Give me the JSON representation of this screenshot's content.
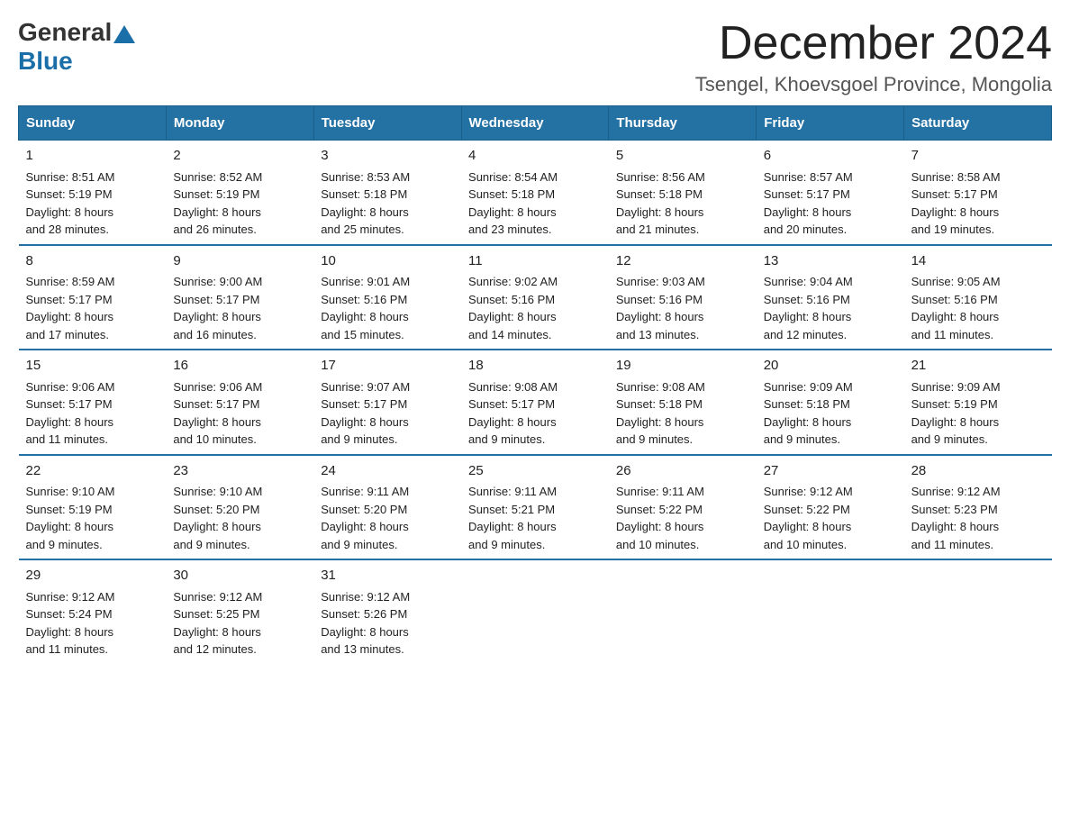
{
  "logo": {
    "general": "General",
    "blue": "Blue"
  },
  "title": "December 2024",
  "location": "Tsengel, Khoevsgoel Province, Mongolia",
  "days_of_week": [
    "Sunday",
    "Monday",
    "Tuesday",
    "Wednesday",
    "Thursday",
    "Friday",
    "Saturday"
  ],
  "weeks": [
    [
      {
        "day": "1",
        "sunrise": "8:51 AM",
        "sunset": "5:19 PM",
        "daylight": "8 hours and 28 minutes."
      },
      {
        "day": "2",
        "sunrise": "8:52 AM",
        "sunset": "5:19 PM",
        "daylight": "8 hours and 26 minutes."
      },
      {
        "day": "3",
        "sunrise": "8:53 AM",
        "sunset": "5:18 PM",
        "daylight": "8 hours and 25 minutes."
      },
      {
        "day": "4",
        "sunrise": "8:54 AM",
        "sunset": "5:18 PM",
        "daylight": "8 hours and 23 minutes."
      },
      {
        "day": "5",
        "sunrise": "8:56 AM",
        "sunset": "5:18 PM",
        "daylight": "8 hours and 21 minutes."
      },
      {
        "day": "6",
        "sunrise": "8:57 AM",
        "sunset": "5:17 PM",
        "daylight": "8 hours and 20 minutes."
      },
      {
        "day": "7",
        "sunrise": "8:58 AM",
        "sunset": "5:17 PM",
        "daylight": "8 hours and 19 minutes."
      }
    ],
    [
      {
        "day": "8",
        "sunrise": "8:59 AM",
        "sunset": "5:17 PM",
        "daylight": "8 hours and 17 minutes."
      },
      {
        "day": "9",
        "sunrise": "9:00 AM",
        "sunset": "5:17 PM",
        "daylight": "8 hours and 16 minutes."
      },
      {
        "day": "10",
        "sunrise": "9:01 AM",
        "sunset": "5:16 PM",
        "daylight": "8 hours and 15 minutes."
      },
      {
        "day": "11",
        "sunrise": "9:02 AM",
        "sunset": "5:16 PM",
        "daylight": "8 hours and 14 minutes."
      },
      {
        "day": "12",
        "sunrise": "9:03 AM",
        "sunset": "5:16 PM",
        "daylight": "8 hours and 13 minutes."
      },
      {
        "day": "13",
        "sunrise": "9:04 AM",
        "sunset": "5:16 PM",
        "daylight": "8 hours and 12 minutes."
      },
      {
        "day": "14",
        "sunrise": "9:05 AM",
        "sunset": "5:16 PM",
        "daylight": "8 hours and 11 minutes."
      }
    ],
    [
      {
        "day": "15",
        "sunrise": "9:06 AM",
        "sunset": "5:17 PM",
        "daylight": "8 hours and 11 minutes."
      },
      {
        "day": "16",
        "sunrise": "9:06 AM",
        "sunset": "5:17 PM",
        "daylight": "8 hours and 10 minutes."
      },
      {
        "day": "17",
        "sunrise": "9:07 AM",
        "sunset": "5:17 PM",
        "daylight": "8 hours and 9 minutes."
      },
      {
        "day": "18",
        "sunrise": "9:08 AM",
        "sunset": "5:17 PM",
        "daylight": "8 hours and 9 minutes."
      },
      {
        "day": "19",
        "sunrise": "9:08 AM",
        "sunset": "5:18 PM",
        "daylight": "8 hours and 9 minutes."
      },
      {
        "day": "20",
        "sunrise": "9:09 AM",
        "sunset": "5:18 PM",
        "daylight": "8 hours and 9 minutes."
      },
      {
        "day": "21",
        "sunrise": "9:09 AM",
        "sunset": "5:19 PM",
        "daylight": "8 hours and 9 minutes."
      }
    ],
    [
      {
        "day": "22",
        "sunrise": "9:10 AM",
        "sunset": "5:19 PM",
        "daylight": "8 hours and 9 minutes."
      },
      {
        "day": "23",
        "sunrise": "9:10 AM",
        "sunset": "5:20 PM",
        "daylight": "8 hours and 9 minutes."
      },
      {
        "day": "24",
        "sunrise": "9:11 AM",
        "sunset": "5:20 PM",
        "daylight": "8 hours and 9 minutes."
      },
      {
        "day": "25",
        "sunrise": "9:11 AM",
        "sunset": "5:21 PM",
        "daylight": "8 hours and 9 minutes."
      },
      {
        "day": "26",
        "sunrise": "9:11 AM",
        "sunset": "5:22 PM",
        "daylight": "8 hours and 10 minutes."
      },
      {
        "day": "27",
        "sunrise": "9:12 AM",
        "sunset": "5:22 PM",
        "daylight": "8 hours and 10 minutes."
      },
      {
        "day": "28",
        "sunrise": "9:12 AM",
        "sunset": "5:23 PM",
        "daylight": "8 hours and 11 minutes."
      }
    ],
    [
      {
        "day": "29",
        "sunrise": "9:12 AM",
        "sunset": "5:24 PM",
        "daylight": "8 hours and 11 minutes."
      },
      {
        "day": "30",
        "sunrise": "9:12 AM",
        "sunset": "5:25 PM",
        "daylight": "8 hours and 12 minutes."
      },
      {
        "day": "31",
        "sunrise": "9:12 AM",
        "sunset": "5:26 PM",
        "daylight": "8 hours and 13 minutes."
      },
      null,
      null,
      null,
      null
    ]
  ]
}
